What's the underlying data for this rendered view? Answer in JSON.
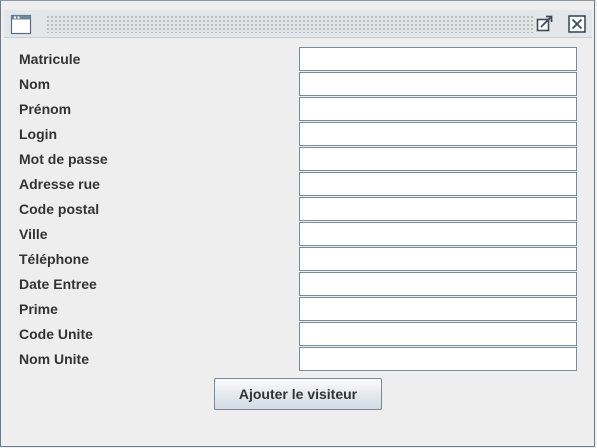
{
  "window": {
    "icon": "window-icon",
    "buttons": {
      "maximize_icon": "maximize-icon",
      "close_icon": "close-icon"
    }
  },
  "form": {
    "fields": [
      {
        "label": "Matricule",
        "value": ""
      },
      {
        "label": "Nom",
        "value": ""
      },
      {
        "label": "Prénom",
        "value": ""
      },
      {
        "label": "Login",
        "value": ""
      },
      {
        "label": "Mot de passe",
        "value": ""
      },
      {
        "label": "Adresse rue",
        "value": ""
      },
      {
        "label": "Code postal",
        "value": ""
      },
      {
        "label": "Ville",
        "value": ""
      },
      {
        "label": "Téléphone",
        "value": ""
      },
      {
        "label": "Date Entree",
        "value": ""
      },
      {
        "label": "Prime",
        "value": ""
      },
      {
        "label": "Code Unite",
        "value": ""
      },
      {
        "label": "Nom Unite",
        "value": ""
      }
    ],
    "submit_label": "Ajouter le visiteur"
  },
  "colors": {
    "background": "#eeeeee",
    "field_border": "#7a8a99",
    "label_text": "#333333"
  }
}
